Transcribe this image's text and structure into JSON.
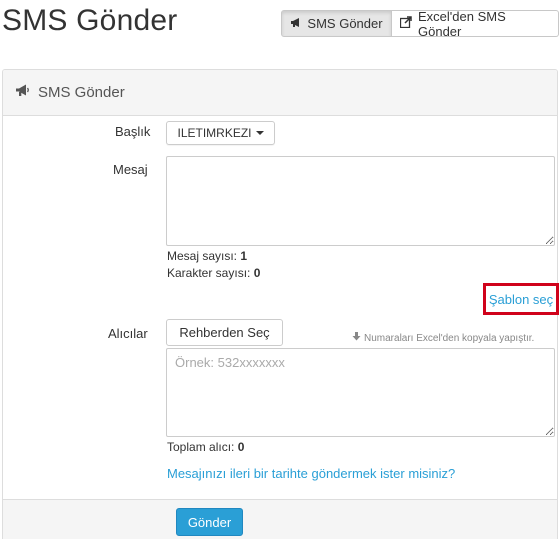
{
  "page": {
    "title": "SMS Gönder"
  },
  "top_actions": {
    "sms_send_label": "SMS Gönder",
    "excel_send_label": "Excel'den SMS Gönder"
  },
  "panel": {
    "heading": "SMS Gönder"
  },
  "form": {
    "baslik_label": "Başlık",
    "baslik_value": "ILETIMRKEZI",
    "mesaj_label": "Mesaj",
    "mesaj_value": "",
    "mesaj_sayisi_label": "Mesaj sayısı:",
    "mesaj_sayisi_value": "1",
    "karakter_sayisi_label": "Karakter sayısı:",
    "karakter_sayisi_value": "0",
    "sablon_link": "Şablon seç",
    "alicilar_label": "Alıcılar",
    "rehber_button": "Rehberden Seç",
    "excel_hint": "Numaraları Excel'den kopyala yapıştır.",
    "alicilar_placeholder": "Örnek: 532xxxxxxx",
    "toplam_alici_label": "Toplam alıcı:",
    "toplam_alici_value": "0",
    "schedule_link": "Mesajınızı ileri bir tarihte göndermek ister misiniz?",
    "send_button": "Gönder"
  },
  "colors": {
    "link": "#2a9fd6",
    "primary": "#2a9fd6",
    "highlight": "#d0021b"
  },
  "icons": [
    "bullhorn-icon",
    "external-link-icon",
    "arrow-down-icon",
    "caret-down-icon"
  ]
}
